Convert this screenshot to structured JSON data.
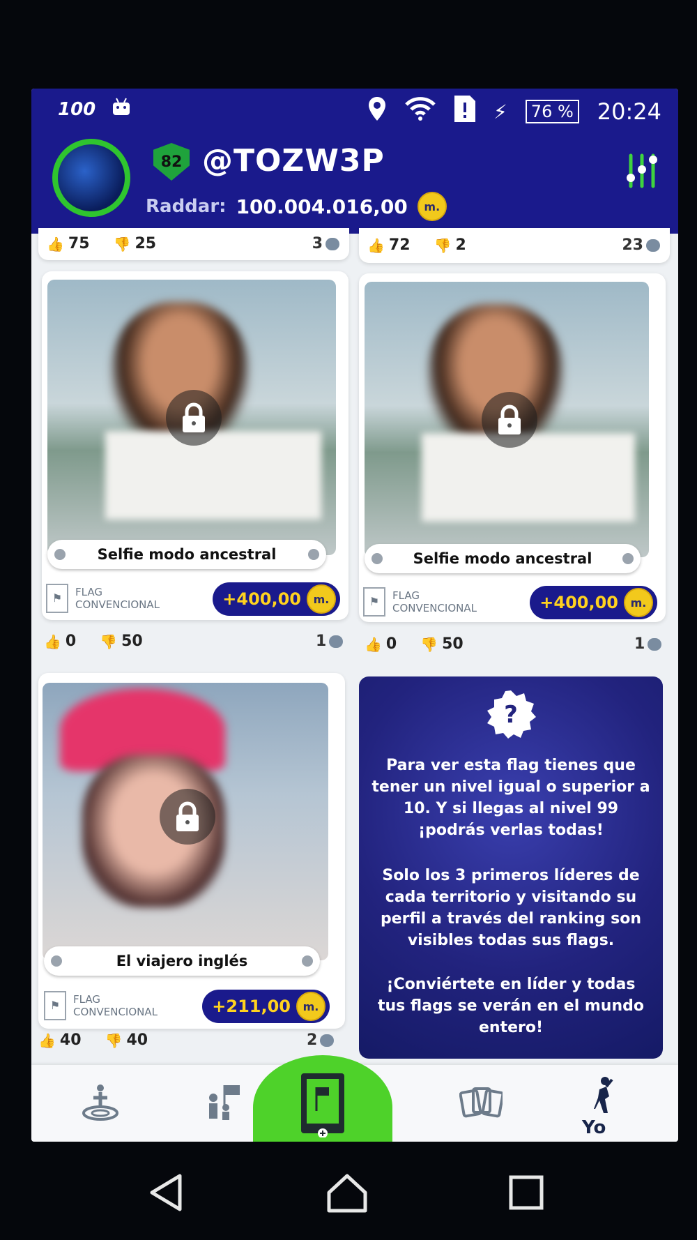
{
  "status_bar": {
    "left_icons": [
      "radio-100-icon",
      "android-icon"
    ],
    "left_text": "100",
    "battery": "76 %",
    "time": "20:24"
  },
  "header": {
    "level": "82",
    "username": "@TOZW3P",
    "raddar_label": "Raddar:",
    "raddar_value": "100.004.016,00",
    "coin_symbol": "m."
  },
  "cards": [
    {
      "likes": "75",
      "dislikes": "25",
      "comments": "3"
    },
    {
      "likes": "72",
      "dislikes": "2",
      "comments": "23"
    },
    {
      "title": "Selfie modo ancestral",
      "flag_type_1": "FLAG",
      "flag_type_2": "CONVENCIONAL",
      "price": "+400,00",
      "likes": "0",
      "dislikes": "50",
      "comments": "1"
    },
    {
      "title": "Selfie modo ancestral",
      "flag_type_1": "FLAG",
      "flag_type_2": "CONVENCIONAL",
      "price": "+400,00",
      "likes": "0",
      "dislikes": "50",
      "comments": "1"
    },
    {
      "title": "El viajero inglés",
      "flag_type_1": "FLAG",
      "flag_type_2": "CONVENCIONAL",
      "price": "+211,00",
      "likes": "40",
      "dislikes": "40",
      "comments": "2"
    }
  ],
  "info": {
    "p1": "Para ver esta flag tienes que tener un nivel igual o superior a 10. Y si llegas al nivel 99 ¡podrás verlas todas!",
    "p2": "Solo los 3 primeros líderes de cada territorio y visitando su perfil a través del ranking son visibles todas sus flags.",
    "p3": "¡Conviértete en líder y todas tus flags se verán en el mundo entero!"
  },
  "nav": {
    "items": [
      "radar-person-icon",
      "group-flag-icon",
      "add-flag-icon",
      "cards-icon",
      "profile-person-icon"
    ],
    "yo_label": "Yo"
  },
  "colors": {
    "header": "#1a1a8c",
    "accent_green": "#4ed22a",
    "coin": "#f2c91c",
    "price_text": "#ffd21f"
  }
}
